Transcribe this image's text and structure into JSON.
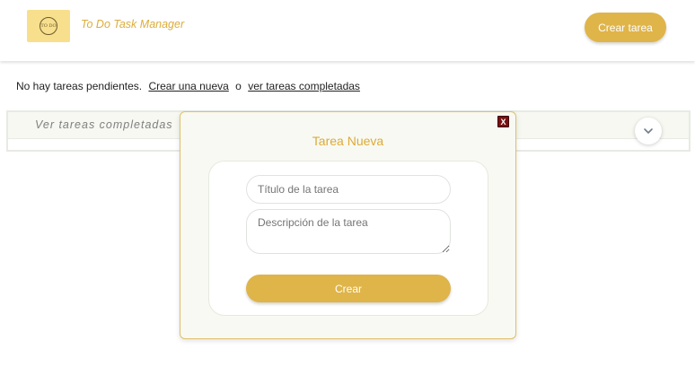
{
  "header": {
    "logo_text": "TO DO",
    "title": "To Do Task Manager",
    "create_button": "Crear tarea"
  },
  "status": {
    "message": "No hay tareas pendientes.",
    "create_link": "Crear una nueva",
    "separator": "o",
    "completed_link": "ver tareas completadas"
  },
  "accordion": {
    "title": "Ver tareas completadas",
    "toggle_icon": "chevron-down-icon"
  },
  "modal": {
    "close_label": "X",
    "title": "Tarea Nueva",
    "title_placeholder": "Título de la tarea",
    "description_placeholder": "Descripción de la tarea",
    "submit_label": "Crear"
  },
  "colors": {
    "accent": "#dfb449",
    "logo_bg": "#f7df8e",
    "close_bg": "#7a1010"
  }
}
